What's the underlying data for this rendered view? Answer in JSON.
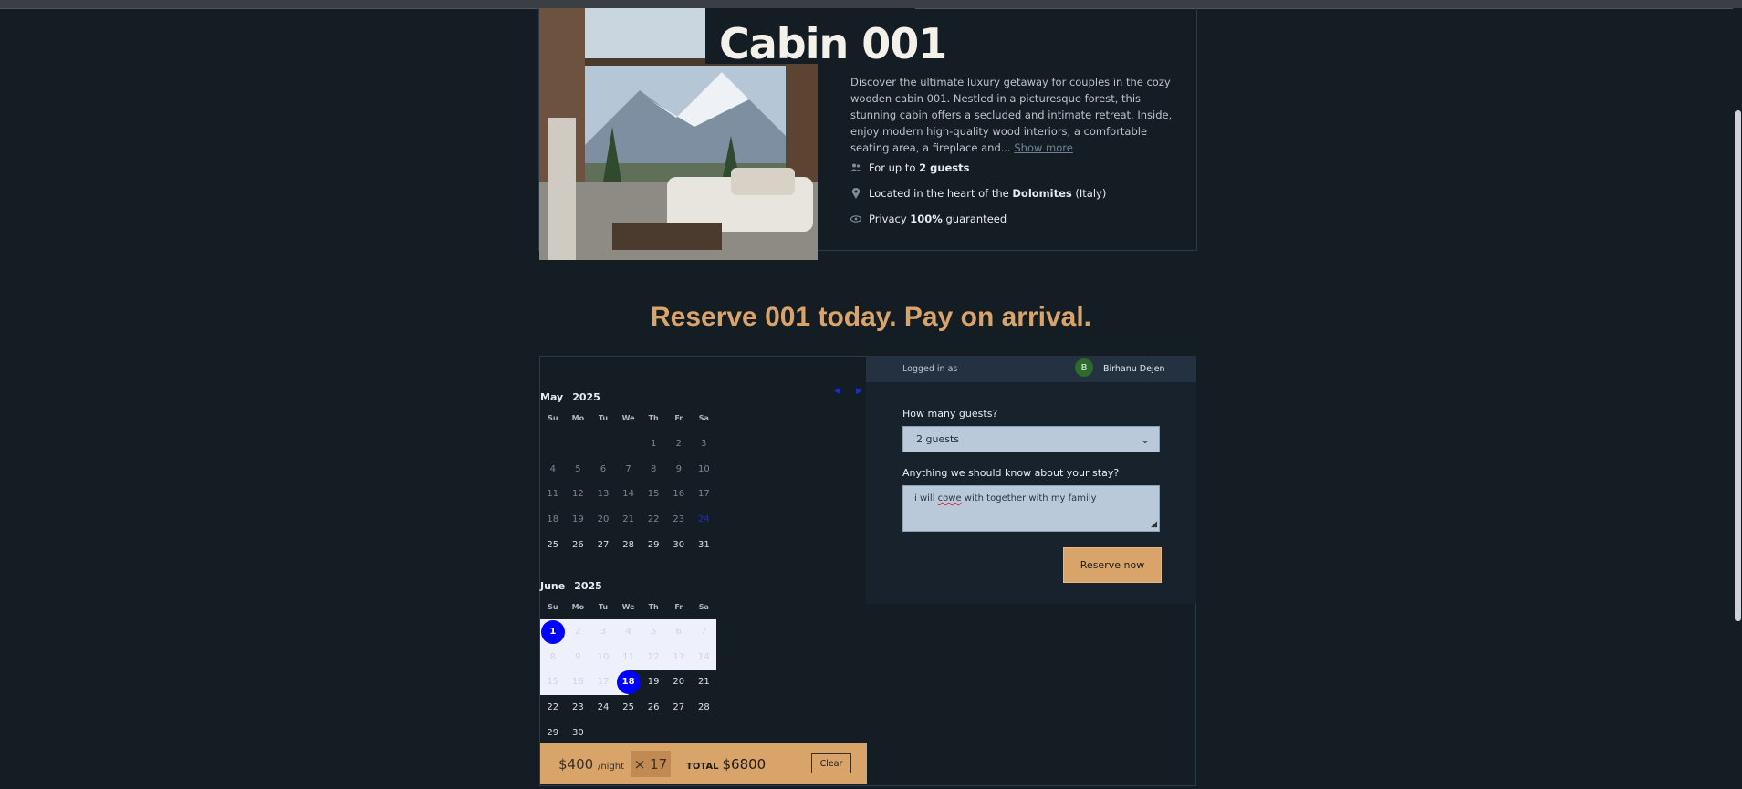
{
  "cabin": {
    "title": "Cabin 001",
    "description": "Discover the ultimate luxury getaway for couples in the cozy wooden cabin 001. Nestled in a picturesque forest, this stunning cabin offers a secluded and intimate retreat. Inside, enjoy modern high-quality wood interiors, a comfortable seating area, a fireplace and...",
    "show_more": "Show more",
    "features": {
      "guests_pre": "For up to ",
      "guests_bold": "2 guests",
      "location_pre": "Located in the heart of the ",
      "location_bold": "Dolomites",
      "location_post": " (Italy)",
      "privacy_pre": "Privacy ",
      "privacy_bold": "100%",
      "privacy_post": " guaranteed"
    }
  },
  "headline": "Reserve 001 today. Pay on arrival.",
  "calendar": {
    "weekdays": [
      "Su",
      "Mo",
      "Tu",
      "We",
      "Th",
      "Fr",
      "Sa"
    ],
    "month1": {
      "name": "May",
      "year": "2025"
    },
    "month2": {
      "name": "June",
      "year": "2025"
    },
    "may_days": [
      "",
      "",
      "",
      "",
      "1",
      "2",
      "3",
      "4",
      "5",
      "6",
      "7",
      "8",
      "9",
      "10",
      "11",
      "12",
      "13",
      "14",
      "15",
      "16",
      "17",
      "18",
      "19",
      "20",
      "21",
      "22",
      "23",
      "24",
      "25",
      "26",
      "27",
      "28",
      "29",
      "30",
      "31"
    ],
    "june_days": [
      "1",
      "2",
      "3",
      "4",
      "5",
      "6",
      "7",
      "8",
      "9",
      "10",
      "11",
      "12",
      "13",
      "14",
      "15",
      "16",
      "17",
      "18",
      "19",
      "20",
      "21",
      "22",
      "23",
      "24",
      "25",
      "26",
      "27",
      "28",
      "29",
      "30"
    ]
  },
  "reservation": {
    "logged_in_label": "Logged in as",
    "avatar_initial": "B",
    "user_name": "Birhanu Dejen",
    "guests_label": "How many guests?",
    "guests_value": "2 guests",
    "notes_label": "Anything we should know about your stay?",
    "notes_pre": "i will ",
    "notes_err": "cowe",
    "notes_post": " with together with my family",
    "reserve_button": "Reserve now"
  },
  "pricing": {
    "price": "$400",
    "per": "/night",
    "nights": "× 17",
    "total_label": "TOTAL",
    "total_value": "$6800",
    "clear_button": "Clear"
  },
  "colors": {
    "accent": "#d9a46a",
    "background": "#141c24",
    "selected_day": "#0000ff"
  }
}
